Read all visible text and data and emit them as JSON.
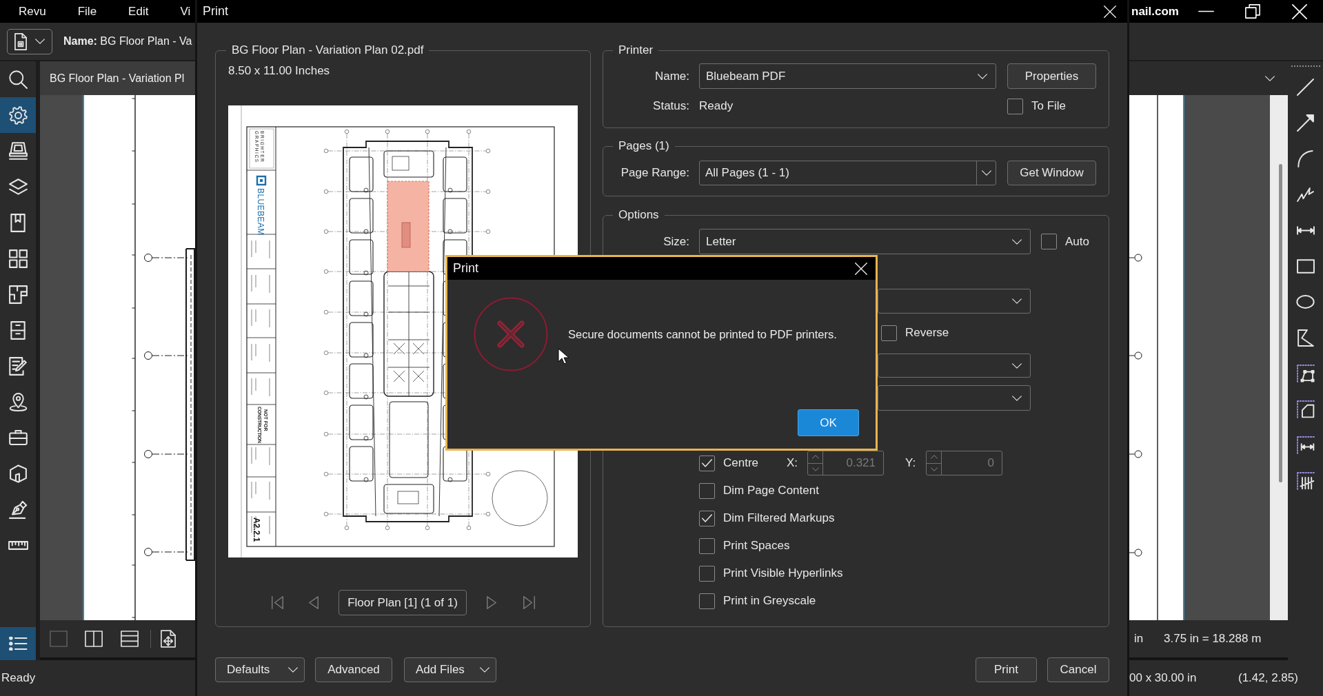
{
  "app": {
    "menu": [
      "Revu",
      "File",
      "Edit",
      "Vi"
    ],
    "account": "nail.com",
    "document_name": "**Name:** BG Floor Plan - Va",
    "sidebar": [
      {
        "selected": false
      },
      {
        "selected": true
      },
      {
        "selected": false
      },
      {
        "selected": false
      },
      {
        "selected": false
      },
      {
        "selected": false
      },
      {
        "selected": false
      },
      {
        "selected": false
      },
      {
        "selected": false
      },
      {
        "selected": false
      },
      {
        "selected": false
      },
      {
        "selected": false
      },
      {
        "selected": false
      },
      {
        "selected": false
      }
    ],
    "panel_toggle": {
      "selected": true
    },
    "document_tab": {
      "label": "BG Floor Plan - Variation Pl",
      "selected": true
    },
    "view_buttons": [
      {
        "disabled": true
      },
      {
        "disabled": false
      },
      {
        "disabled": false
      },
      {
        "disabled": false
      }
    ],
    "bottom_bar": {
      "fragment": "in",
      "scale": "3.75 in = 18.288 m"
    },
    "status_bar": {
      "status": "Ready",
      "dimensions": "00 x 30.00 in",
      "coordinates": "(1.42, 2.85)"
    }
  },
  "print_dialog": {
    "title": "Print",
    "document": {
      "legend": "BG Floor Plan - Variation Plan 02.pdf",
      "size": "8.50 x 11.00 Inches"
    },
    "preview": {
      "brand": [
        "BRIGHTER",
        "GRAPHICS"
      ],
      "logo": "BLUEBEAM",
      "stamp": [
        "NOT FOR",
        "CONSTRUCTION"
      ],
      "sheet_number": "A2.2.1"
    },
    "page_nav": {
      "label": "Floor Plan [1] (1 of 1)",
      "buttons": [
        {
          "disabled": true
        },
        {
          "disabled": true
        },
        {
          "disabled": true
        },
        {
          "disabled": true
        }
      ]
    },
    "printer": {
      "legend": "Printer",
      "name_label": "Name:",
      "name_value": "Bluebeam PDF",
      "properties": "Properties",
      "status_label": "Status:",
      "status_value": "Ready",
      "to_file": {
        "label": "To File",
        "checked": false
      }
    },
    "pages": {
      "legend": "Pages (1)",
      "range_label": "Page Range:",
      "range_value": "All Pages (1 - 1)",
      "get_window": "Get Window"
    },
    "options": {
      "legend": "Options",
      "size_label": "Size:",
      "size_value": "Letter",
      "auto": {
        "label": "Auto",
        "checked": false
      },
      "reverse": {
        "label": "Reverse",
        "checked": false
      },
      "centre": {
        "label": "Centre",
        "checked": true
      },
      "x": {
        "label": "X:",
        "value": "0.321",
        "disabled": true
      },
      "y": {
        "label": "Y:",
        "value": "0",
        "disabled": true
      },
      "checkboxes": [
        {
          "label": "Dim Page Content",
          "checked": false
        },
        {
          "label": "Dim Filtered Markups",
          "checked": true
        },
        {
          "label": "Print Spaces",
          "checked": false
        },
        {
          "label": "Print Visible Hyperlinks",
          "checked": false
        },
        {
          "label": "Print in Greyscale",
          "checked": false
        }
      ]
    },
    "buttons": [
      {
        "label": "Defaults",
        "kind": "dropdown"
      },
      {
        "label": "Advanced",
        "kind": "plain"
      },
      {
        "label": "Add Files",
        "kind": "dropdown"
      }
    ],
    "actions": [
      "Print",
      "Cancel"
    ]
  },
  "alert": {
    "title": "Print",
    "message": "Secure documents cannot be printed to PDF printers.",
    "ok": "OK"
  }
}
